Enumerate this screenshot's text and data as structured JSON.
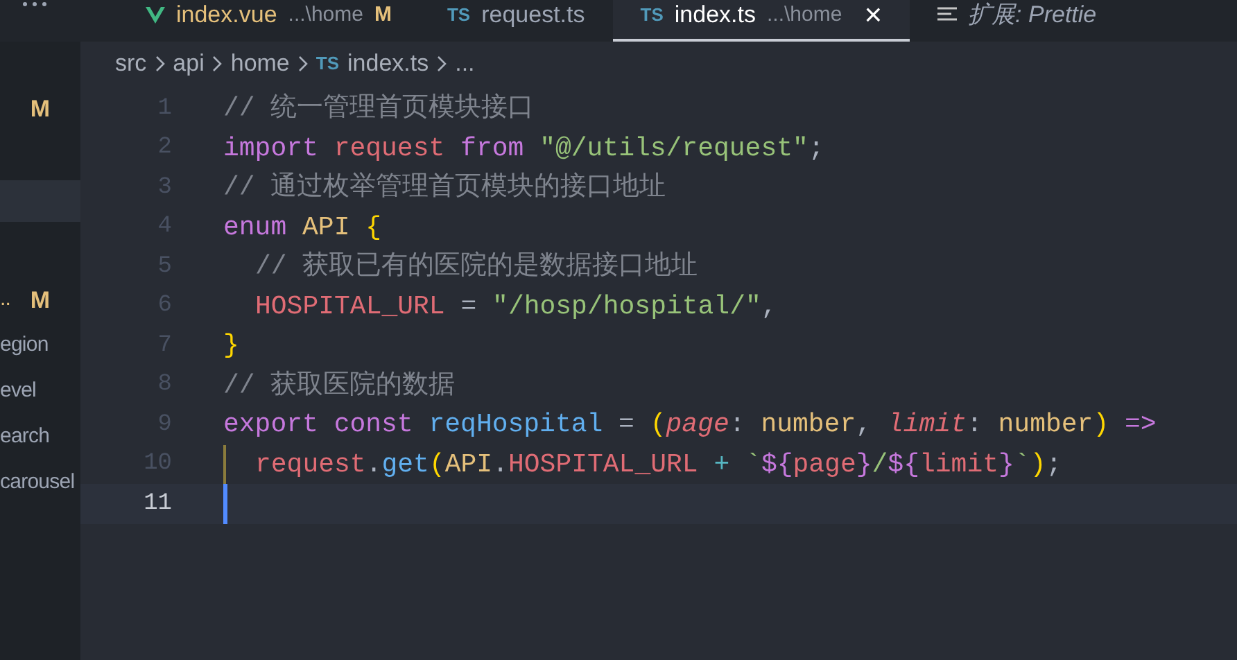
{
  "tabs": [
    {
      "kind": "vue",
      "label": "index.vue",
      "description": "...\\home",
      "badge": "M",
      "selected": false,
      "preview": false
    },
    {
      "kind": "ts",
      "icon_text": "TS",
      "label": "request.ts",
      "selected": false,
      "preview": false
    },
    {
      "kind": "ts",
      "icon_text": "TS",
      "label": "index.ts",
      "description": "...\\home",
      "close": "×",
      "selected": true,
      "preview": false
    },
    {
      "kind": "list",
      "label": "扩展: Prettie",
      "selected": false,
      "preview": true
    }
  ],
  "sidebar": {
    "items": [
      {
        "badge": "M"
      },
      {
        "label": "..",
        "badge": "M"
      },
      {
        "label": "egion"
      },
      {
        "label": "evel"
      },
      {
        "label": "earch"
      },
      {
        "label": "carousel"
      }
    ]
  },
  "breadcrumbs": [
    {
      "label": "src"
    },
    {
      "label": "api"
    },
    {
      "label": "home"
    },
    {
      "label": "index.ts",
      "icon_text": "TS"
    },
    {
      "label": "..."
    }
  ],
  "code": [
    {
      "number": "1",
      "tokens": [
        {
          "kind": "comment",
          "text": "// 统一管理首页模块接口"
        }
      ]
    },
    {
      "number": "2",
      "tokens": [
        {
          "kind": "keyword",
          "text": "import "
        },
        {
          "kind": "variable",
          "text": "request "
        },
        {
          "kind": "keyword",
          "text": "from "
        },
        {
          "kind": "string",
          "text": "\"@/utils/request\""
        },
        {
          "kind": "plain",
          "text": ";"
        }
      ]
    },
    {
      "number": "3",
      "tokens": [
        {
          "kind": "comment",
          "text": "// 通过枚举管理首页模块的接口地址"
        }
      ]
    },
    {
      "number": "4",
      "tokens": [
        {
          "kind": "keyword",
          "text": "enum "
        },
        {
          "kind": "type",
          "text": "API "
        },
        {
          "kind": "bracket",
          "text": "{"
        }
      ]
    },
    {
      "number": "5",
      "indented": true,
      "tokens": [
        {
          "kind": "comment",
          "text": "// 获取已有的医院的是数据接口地址"
        }
      ]
    },
    {
      "number": "6",
      "indented": true,
      "tokens": [
        {
          "kind": "variable",
          "text": "HOSPITAL_URL"
        },
        {
          "kind": "plain",
          "text": " = "
        },
        {
          "kind": "string",
          "text": "\"/hosp/hospital/\""
        },
        {
          "kind": "plain",
          "text": ","
        }
      ]
    },
    {
      "number": "7",
      "tokens": [
        {
          "kind": "bracket",
          "text": "}"
        }
      ]
    },
    {
      "number": "8",
      "tokens": [
        {
          "kind": "comment",
          "text": "// 获取医院的数据"
        }
      ]
    },
    {
      "number": "9",
      "tokens": [
        {
          "kind": "keyword",
          "text": "export const "
        },
        {
          "kind": "function",
          "text": "reqHospital"
        },
        {
          "kind": "plain",
          "text": " = "
        },
        {
          "kind": "bracket",
          "text": "("
        },
        {
          "kind": "param",
          "text": "page"
        },
        {
          "kind": "plain",
          "text": ": "
        },
        {
          "kind": "type",
          "text": "number"
        },
        {
          "kind": "plain",
          "text": ", "
        },
        {
          "kind": "param",
          "text": "limit"
        },
        {
          "kind": "plain",
          "text": ": "
        },
        {
          "kind": "type",
          "text": "number"
        },
        {
          "kind": "bracket",
          "text": ")"
        },
        {
          "kind": "keyword",
          "text": " =>"
        }
      ]
    },
    {
      "number": "10",
      "guide": true,
      "indented": true,
      "tokens": [
        {
          "kind": "variable",
          "text": "request"
        },
        {
          "kind": "plain",
          "text": "."
        },
        {
          "kind": "function",
          "text": "get"
        },
        {
          "kind": "bracket",
          "text": "("
        },
        {
          "kind": "type",
          "text": "API"
        },
        {
          "kind": "plain",
          "text": "."
        },
        {
          "kind": "variable",
          "text": "HOSPITAL_URL"
        },
        {
          "kind": "operator",
          "text": " + "
        },
        {
          "kind": "string",
          "text": "`"
        },
        {
          "kind": "keyword",
          "text": "${"
        },
        {
          "kind": "variable",
          "text": "page"
        },
        {
          "kind": "keyword",
          "text": "}"
        },
        {
          "kind": "string",
          "text": "/"
        },
        {
          "kind": "keyword",
          "text": "${"
        },
        {
          "kind": "variable",
          "text": "limit"
        },
        {
          "kind": "keyword",
          "text": "}"
        },
        {
          "kind": "string",
          "text": "`"
        },
        {
          "kind": "bracket",
          "text": ")"
        },
        {
          "kind": "plain",
          "text": ";"
        }
      ]
    },
    {
      "number": "11",
      "current": true
    }
  ]
}
